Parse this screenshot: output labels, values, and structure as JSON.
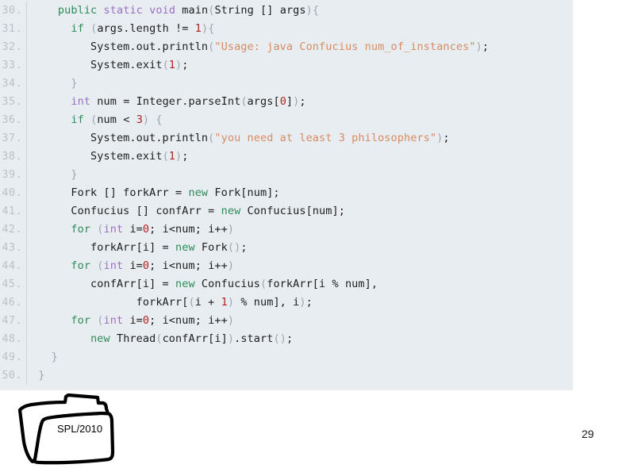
{
  "slide": {
    "page_number": "29",
    "background_color": "#ffffff"
  },
  "code_block": {
    "background_color": "#e8edf1",
    "language": "java",
    "gutter_color": "#b9c2ca",
    "colors": {
      "keyword": "#2e8b57",
      "type": "#9b6fc4",
      "number": "#b22222",
      "string": "#d98a62",
      "punctuation": "#9aa7b2",
      "plain": "#1d1d1d"
    },
    "lines": [
      {
        "number": "30.",
        "tokens": [
          {
            "t": "    ",
            "c": "plain"
          },
          {
            "t": "public",
            "c": "keyword"
          },
          {
            "t": " ",
            "c": "plain"
          },
          {
            "t": "static",
            "c": "type"
          },
          {
            "t": " ",
            "c": "plain"
          },
          {
            "t": "void",
            "c": "type"
          },
          {
            "t": " main",
            "c": "plain"
          },
          {
            "t": "(",
            "c": "punctuation"
          },
          {
            "t": "String [] args",
            "c": "plain"
          },
          {
            "t": ")",
            "c": "punctuation"
          },
          {
            "t": "{",
            "c": "punctuation"
          }
        ]
      },
      {
        "number": "31.",
        "tokens": [
          {
            "t": "      ",
            "c": "plain"
          },
          {
            "t": "if",
            "c": "keyword"
          },
          {
            "t": " ",
            "c": "plain"
          },
          {
            "t": "(",
            "c": "punctuation"
          },
          {
            "t": "args.length != ",
            "c": "plain"
          },
          {
            "t": "1",
            "c": "number"
          },
          {
            "t": ")",
            "c": "punctuation"
          },
          {
            "t": "{",
            "c": "punctuation"
          }
        ]
      },
      {
        "number": "32.",
        "tokens": [
          {
            "t": "         System.out.println",
            "c": "plain"
          },
          {
            "t": "(",
            "c": "punctuation"
          },
          {
            "t": "\"Usage: java Confucius num_of_instances\"",
            "c": "string"
          },
          {
            "t": ")",
            "c": "punctuation"
          },
          {
            "t": ";",
            "c": "plain"
          }
        ]
      },
      {
        "number": "33.",
        "tokens": [
          {
            "t": "         System.exit",
            "c": "plain"
          },
          {
            "t": "(",
            "c": "punctuation"
          },
          {
            "t": "1",
            "c": "number"
          },
          {
            "t": ")",
            "c": "punctuation"
          },
          {
            "t": ";",
            "c": "plain"
          }
        ]
      },
      {
        "number": "34.",
        "tokens": [
          {
            "t": "      ",
            "c": "plain"
          },
          {
            "t": "}",
            "c": "punctuation"
          }
        ]
      },
      {
        "number": "35.",
        "tokens": [
          {
            "t": "      ",
            "c": "plain"
          },
          {
            "t": "int",
            "c": "type"
          },
          {
            "t": " num = Integer.parseInt",
            "c": "plain"
          },
          {
            "t": "(",
            "c": "punctuation"
          },
          {
            "t": "args[",
            "c": "plain"
          },
          {
            "t": "0",
            "c": "number"
          },
          {
            "t": "]",
            "c": "plain"
          },
          {
            "t": ")",
            "c": "punctuation"
          },
          {
            "t": ";",
            "c": "plain"
          }
        ]
      },
      {
        "number": "36.",
        "tokens": [
          {
            "t": "      ",
            "c": "plain"
          },
          {
            "t": "if",
            "c": "keyword"
          },
          {
            "t": " ",
            "c": "plain"
          },
          {
            "t": "(",
            "c": "punctuation"
          },
          {
            "t": "num < ",
            "c": "plain"
          },
          {
            "t": "3",
            "c": "number"
          },
          {
            "t": ")",
            "c": "punctuation"
          },
          {
            "t": " ",
            "c": "plain"
          },
          {
            "t": "{",
            "c": "punctuation"
          }
        ]
      },
      {
        "number": "37.",
        "tokens": [
          {
            "t": "         System.out.println",
            "c": "plain"
          },
          {
            "t": "(",
            "c": "punctuation"
          },
          {
            "t": "\"you need at least 3 philosophers\"",
            "c": "string"
          },
          {
            "t": ")",
            "c": "punctuation"
          },
          {
            "t": ";",
            "c": "plain"
          }
        ]
      },
      {
        "number": "38.",
        "tokens": [
          {
            "t": "         System.exit",
            "c": "plain"
          },
          {
            "t": "(",
            "c": "punctuation"
          },
          {
            "t": "1",
            "c": "number"
          },
          {
            "t": ")",
            "c": "punctuation"
          },
          {
            "t": ";",
            "c": "plain"
          }
        ]
      },
      {
        "number": "39.",
        "tokens": [
          {
            "t": "      ",
            "c": "plain"
          },
          {
            "t": "}",
            "c": "punctuation"
          }
        ]
      },
      {
        "number": "40.",
        "tokens": [
          {
            "t": "      Fork [] forkArr = ",
            "c": "plain"
          },
          {
            "t": "new",
            "c": "keyword"
          },
          {
            "t": " Fork[num];",
            "c": "plain"
          }
        ]
      },
      {
        "number": "41.",
        "tokens": [
          {
            "t": "      Confucius [] confArr = ",
            "c": "plain"
          },
          {
            "t": "new",
            "c": "keyword"
          },
          {
            "t": " Confucius[num];",
            "c": "plain"
          }
        ]
      },
      {
        "number": "42.",
        "tokens": [
          {
            "t": "      ",
            "c": "plain"
          },
          {
            "t": "for",
            "c": "keyword"
          },
          {
            "t": " ",
            "c": "plain"
          },
          {
            "t": "(",
            "c": "punctuation"
          },
          {
            "t": "int",
            "c": "type"
          },
          {
            "t": " i=",
            "c": "plain"
          },
          {
            "t": "0",
            "c": "number"
          },
          {
            "t": "; i<num; i++",
            "c": "plain"
          },
          {
            "t": ")",
            "c": "punctuation"
          }
        ]
      },
      {
        "number": "43.",
        "tokens": [
          {
            "t": "         forkArr[i] = ",
            "c": "plain"
          },
          {
            "t": "new",
            "c": "keyword"
          },
          {
            "t": " Fork",
            "c": "plain"
          },
          {
            "t": "()",
            "c": "punctuation"
          },
          {
            "t": ";",
            "c": "plain"
          }
        ]
      },
      {
        "number": "44.",
        "tokens": [
          {
            "t": "      ",
            "c": "plain"
          },
          {
            "t": "for",
            "c": "keyword"
          },
          {
            "t": " ",
            "c": "plain"
          },
          {
            "t": "(",
            "c": "punctuation"
          },
          {
            "t": "int",
            "c": "type"
          },
          {
            "t": " i=",
            "c": "plain"
          },
          {
            "t": "0",
            "c": "number"
          },
          {
            "t": "; i<num; i++",
            "c": "plain"
          },
          {
            "t": ")",
            "c": "punctuation"
          }
        ]
      },
      {
        "number": "45.",
        "tokens": [
          {
            "t": "         confArr[i] = ",
            "c": "plain"
          },
          {
            "t": "new",
            "c": "keyword"
          },
          {
            "t": " Confucius",
            "c": "plain"
          },
          {
            "t": "(",
            "c": "punctuation"
          },
          {
            "t": "forkArr[i % num],",
            "c": "plain"
          }
        ]
      },
      {
        "number": "46.",
        "tokens": [
          {
            "t": "                forkArr[",
            "c": "plain"
          },
          {
            "t": "(",
            "c": "punctuation"
          },
          {
            "t": "i + ",
            "c": "plain"
          },
          {
            "t": "1",
            "c": "number"
          },
          {
            "t": ")",
            "c": "punctuation"
          },
          {
            "t": " % num], i",
            "c": "plain"
          },
          {
            "t": ")",
            "c": "punctuation"
          },
          {
            "t": ";",
            "c": "plain"
          }
        ]
      },
      {
        "number": "47.",
        "tokens": [
          {
            "t": "      ",
            "c": "plain"
          },
          {
            "t": "for",
            "c": "keyword"
          },
          {
            "t": " ",
            "c": "plain"
          },
          {
            "t": "(",
            "c": "punctuation"
          },
          {
            "t": "int",
            "c": "type"
          },
          {
            "t": " i=",
            "c": "plain"
          },
          {
            "t": "0",
            "c": "number"
          },
          {
            "t": "; i<num; i++",
            "c": "plain"
          },
          {
            "t": ")",
            "c": "punctuation"
          }
        ]
      },
      {
        "number": "48.",
        "tokens": [
          {
            "t": "         ",
            "c": "plain"
          },
          {
            "t": "new",
            "c": "keyword"
          },
          {
            "t": " Thread",
            "c": "plain"
          },
          {
            "t": "(",
            "c": "punctuation"
          },
          {
            "t": "confArr[i]",
            "c": "plain"
          },
          {
            "t": ")",
            "c": "punctuation"
          },
          {
            "t": ".start",
            "c": "plain"
          },
          {
            "t": "()",
            "c": "punctuation"
          },
          {
            "t": ";",
            "c": "plain"
          }
        ]
      },
      {
        "number": "49.",
        "tokens": [
          {
            "t": "   ",
            "c": "plain"
          },
          {
            "t": "}",
            "c": "punctuation"
          }
        ]
      },
      {
        "number": "50.",
        "tokens": [
          {
            "t": " ",
            "c": "plain"
          },
          {
            "t": "}",
            "c": "punctuation"
          }
        ]
      }
    ]
  },
  "footer": {
    "logo_label": "SPL/2010",
    "logo_icon": "hand-drawn-folder-icon",
    "logo_stroke_color": "#000000"
  }
}
